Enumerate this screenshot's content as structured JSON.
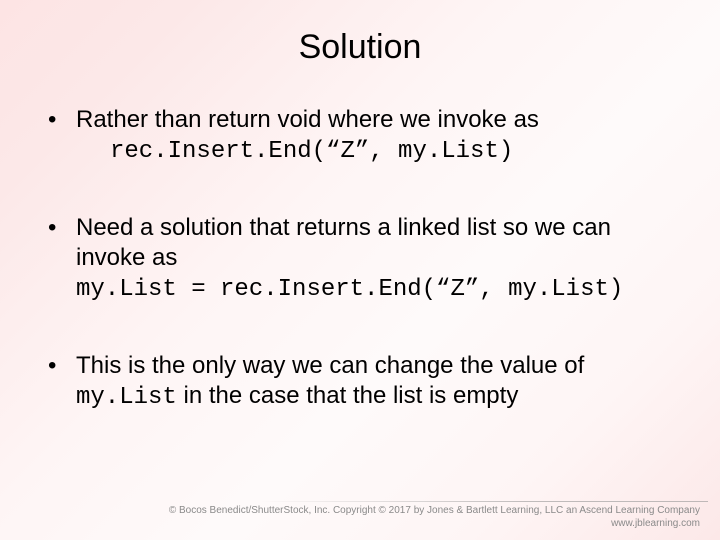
{
  "title": "Solution",
  "bullets": [
    {
      "text": "Rather than return void where we invoke as",
      "code": "rec.Insert.End(“Z”, my.List)"
    },
    {
      "text": "Need a solution that returns a linked list so we can invoke as",
      "code": "my.List = rec.Insert.End(“Z”, my.List)"
    },
    {
      "text_pre": "This is the only way we can change the value of ",
      "code_inline": "my.List",
      "text_post": " in the case that the list is empty"
    }
  ],
  "footer": {
    "line1": "© Bocos Benedict/ShutterStock, Inc. Copyright © 2017 by Jones & Bartlett Learning, LLC an Ascend Learning Company",
    "line2": "www.jblearning.com"
  }
}
